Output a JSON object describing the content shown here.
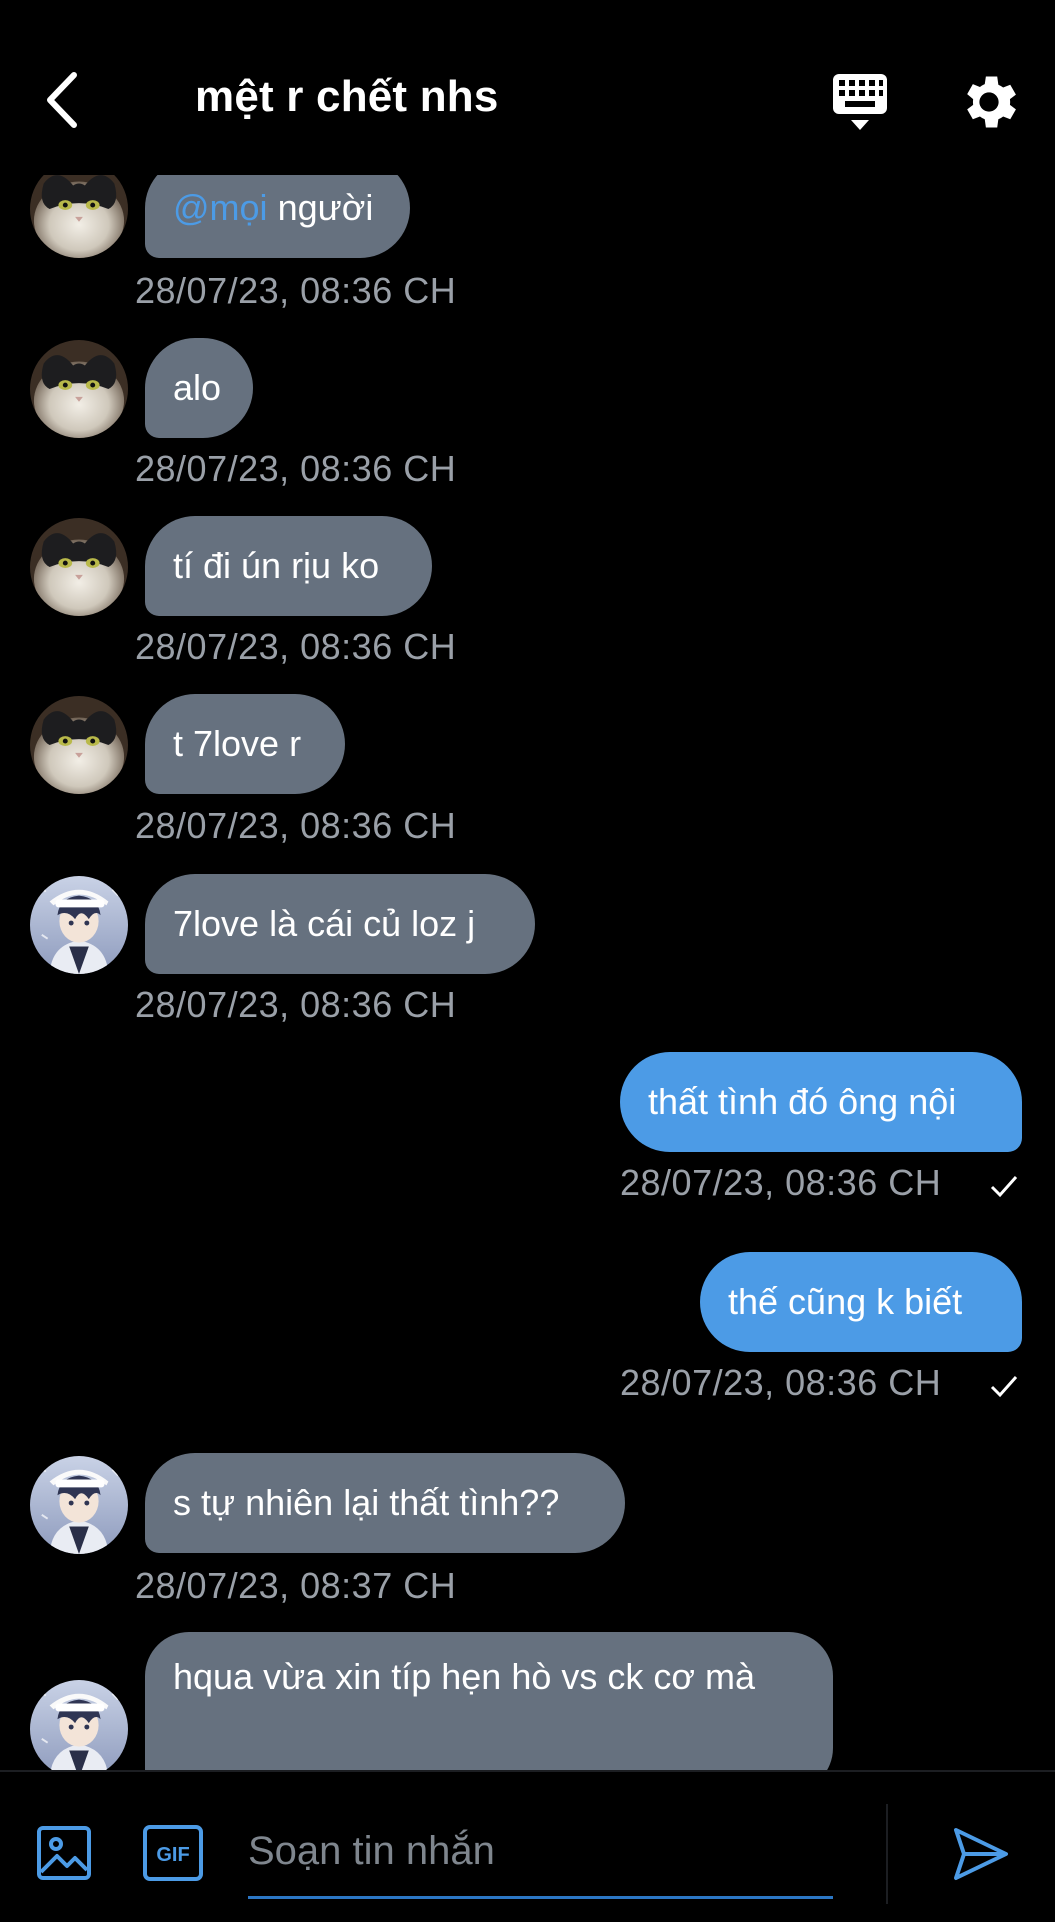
{
  "header": {
    "title": "mệt r chết nhs"
  },
  "colors": {
    "incoming_bubble": "#66717f",
    "outgoing_bubble": "#4c9be6",
    "mention": "#4c9be6",
    "timestamp": "#9aa0a8"
  },
  "messages": [
    {
      "direction": "in",
      "avatar": "cat",
      "mention": "@mọi",
      "text": " người",
      "time": "28/07/23, 08:36 CH"
    },
    {
      "direction": "in",
      "avatar": "cat",
      "text": "alo",
      "time": "28/07/23, 08:36 CH"
    },
    {
      "direction": "in",
      "avatar": "cat",
      "text": "tí đi ún rịu ko",
      "time": "28/07/23, 08:36 CH"
    },
    {
      "direction": "in",
      "avatar": "cat",
      "text": "t 7love r",
      "time": "28/07/23, 08:36 CH"
    },
    {
      "direction": "in",
      "avatar": "anime-boy",
      "text": "7love là cái củ loz j",
      "time": "28/07/23, 08:36 CH"
    },
    {
      "direction": "out",
      "text": "thất tình đó ông nội",
      "time": "28/07/23, 08:36 CH",
      "status": "sent"
    },
    {
      "direction": "out",
      "text": "thế cũng k biết",
      "time": "28/07/23, 08:36 CH",
      "status": "sent"
    },
    {
      "direction": "in",
      "avatar": "anime-boy",
      "text": "s tự nhiên lại thất tình??",
      "time": "28/07/23, 08:37 CH"
    },
    {
      "direction": "in",
      "avatar": "anime-boy",
      "text": "hqua vừa xin típ hẹn hò vs ck cơ mà"
    }
  ],
  "composer": {
    "placeholder": "Soạn tin nhắn",
    "gif_label": "GIF"
  },
  "icons": [
    "back-arrow-icon",
    "keyboard-icon",
    "gear-icon",
    "image-icon",
    "gif-icon",
    "send-icon",
    "check-icon"
  ]
}
